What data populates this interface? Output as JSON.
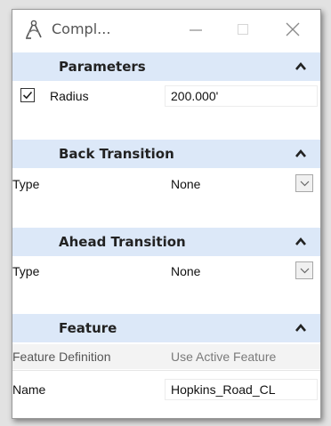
{
  "window": {
    "title": "Compl..."
  },
  "icons": {
    "app": "compass-app-icon",
    "minimize": "minimize-icon",
    "maximize": "maximize-icon",
    "close": "close-icon",
    "collapse": "chevron-up-icon",
    "dropdown": "chevron-down-icon",
    "check": "checkmark-icon"
  },
  "parameters": {
    "title": "Parameters",
    "radius": {
      "label": "Radius",
      "value": "200.000'",
      "checked": true
    }
  },
  "back_transition": {
    "title": "Back Transition",
    "type": {
      "label": "Type",
      "value": "None"
    }
  },
  "ahead_transition": {
    "title": "Ahead Transition",
    "type": {
      "label": "Type",
      "value": "None"
    }
  },
  "feature": {
    "title": "Feature",
    "definition": {
      "label": "Feature Definition",
      "value": "Use Active Feature"
    },
    "name": {
      "label": "Name",
      "value": "Hopkins_Road_CL"
    }
  },
  "colors": {
    "section_header": "#dce8f8",
    "window_bg": "#ffffff",
    "outer_bg": "#e2e2e2"
  }
}
